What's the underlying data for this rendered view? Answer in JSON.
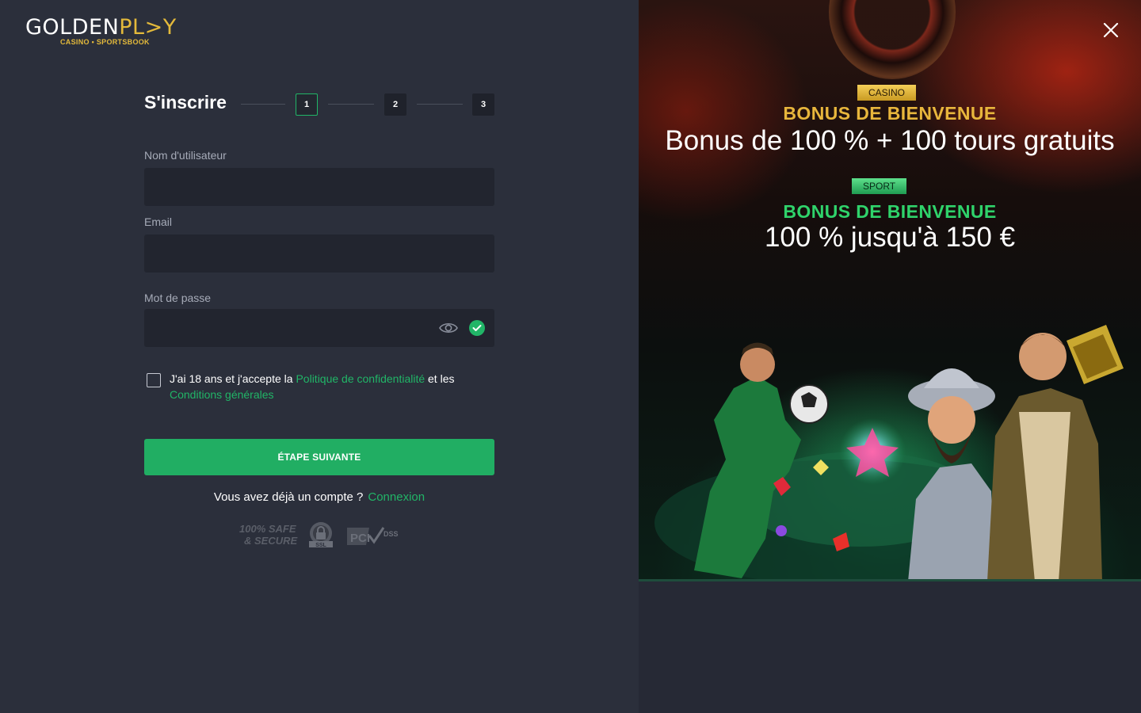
{
  "brand": {
    "logo_main_left": "GOLDEN",
    "logo_main_right": "PL>Y",
    "logo_sub": "CASINO • SPORTSBOOK"
  },
  "form": {
    "title": "S'inscrire",
    "steps": [
      "1",
      "2",
      "3"
    ],
    "active_step": 1,
    "username_label": "Nom d'utilisateur",
    "username_value": "",
    "email_label": "Email",
    "email_value": "",
    "password_label": "Mot de passe",
    "password_value": "",
    "terms_prefix": "J'ai 18 ans et j'accepte la",
    "privacy_link": "Politique de confidentialité",
    "terms_mid": "et les",
    "conditions_link": "Conditions générales",
    "next_button": "ÉTAPE SUIVANTE",
    "login_prompt": "Vous avez déjà un compte ?",
    "login_link": "Connexion"
  },
  "badges": {
    "safe_line1": "100% SAFE",
    "safe_line2": "& SECURE",
    "ssl": "SSL",
    "pci": "PCI",
    "dss": "DSS"
  },
  "promo": {
    "casino_tag": "CASINO",
    "casino_heading": "BONUS DE BIENVENUE",
    "casino_offer": "Bonus de 100 % + 100 tours gratuits",
    "sport_tag": "SPORT",
    "sport_heading": "BONUS DE BIENVENUE",
    "sport_offer": "100 % jusqu'à 150 €"
  },
  "colors": {
    "accent_green": "#21b567",
    "gold": "#e3b93b",
    "panel_bg": "#2b2f3b",
    "input_bg": "#22252f"
  }
}
